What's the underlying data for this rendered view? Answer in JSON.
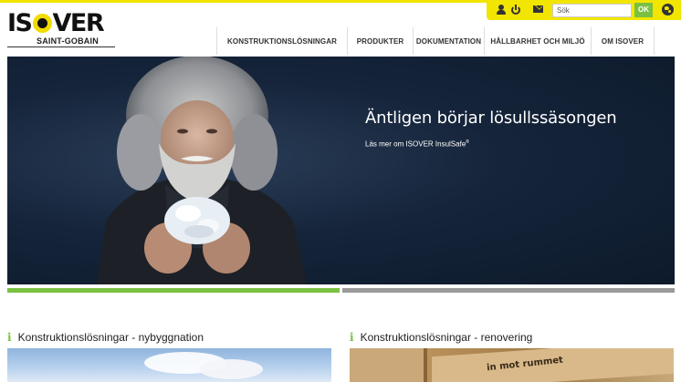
{
  "brand": {
    "logo_text_start": "IS",
    "logo_text_end": "VER",
    "logo_subtitle": "SAINT-GOBAIN",
    "accent_yellow": "#f2e500",
    "accent_green": "#7ac142"
  },
  "utility": {
    "icons": [
      "user-icon",
      "power-icon",
      "mail-icon",
      "globe-icon"
    ],
    "search_placeholder": "Sök",
    "search_button": "OK"
  },
  "nav": {
    "items": [
      {
        "label": "KONSTRUKTIONSLÖSNINGAR"
      },
      {
        "label": "PRODUKTER"
      },
      {
        "label": "DOKUMENTATION"
      },
      {
        "label": "HÅLLBARHET OCH MILJÖ"
      },
      {
        "label": "OM ISOVER"
      }
    ]
  },
  "hero": {
    "title": "Äntligen börjar lösullssäsongen",
    "link_text": "Läs mer om ISOVER InsulSafe",
    "link_sup": "®"
  },
  "carousel": {
    "slides": 2,
    "active_slide": 1
  },
  "sections": [
    {
      "title": "Konstruktionslösningar - nybyggnation"
    },
    {
      "title": "Konstruktionslösningar - renovering",
      "image_text": "in mot rummet"
    }
  ]
}
